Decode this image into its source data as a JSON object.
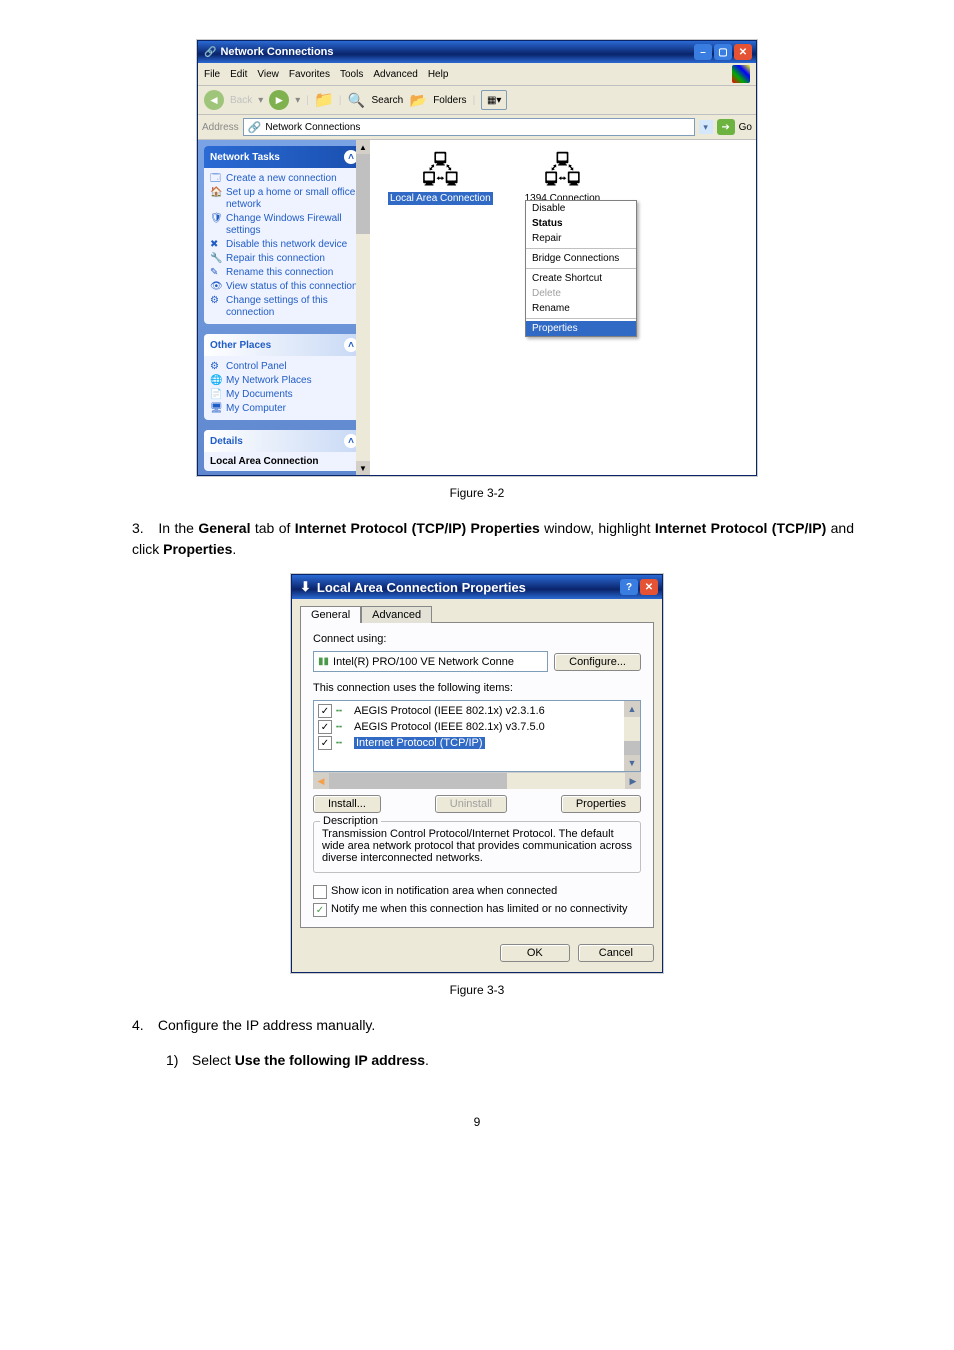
{
  "figure1": {
    "window_title": "Network Connections",
    "menu": [
      "File",
      "Edit",
      "View",
      "Favorites",
      "Tools",
      "Advanced",
      "Help"
    ],
    "toolbar": {
      "back": "Back",
      "search": "Search",
      "folders": "Folders"
    },
    "address_label": "Address",
    "address_value": "Network Connections",
    "go": "Go",
    "tasks": {
      "header": "Network Tasks",
      "items": [
        "Create a new connection",
        "Set up a home or small office network",
        "Change Windows Firewall settings",
        "Disable this network device",
        "Repair this connection",
        "Rename this connection",
        "View status of this connection",
        "Change settings of this connection"
      ]
    },
    "other_places": {
      "header": "Other Places",
      "items": [
        "Control Panel",
        "My Network Places",
        "My Documents",
        "My Computer"
      ]
    },
    "details": {
      "header": "Details",
      "title": "Local Area Connection"
    },
    "icons": {
      "lac": "Local Area Connection",
      "c1394": "1394 Connection"
    },
    "context_menu": {
      "disable": "Disable",
      "status": "Status",
      "repair": "Repair",
      "bridge": "Bridge Connections",
      "shortcut": "Create Shortcut",
      "delete": "Delete",
      "rename": "Rename",
      "properties": "Properties"
    },
    "caption": "Figure 3-2"
  },
  "step3": {
    "num": "3.",
    "text_before": "In the ",
    "bold1": "General",
    "text_mid1": " tab of ",
    "bold2": "Internet Protocol (TCP/IP) Properties",
    "text_mid2": " window, highlight ",
    "bold3": "Internet Protocol (TCP/IP)",
    "text_mid3": " and click ",
    "bold4": "Properties",
    "text_end": "."
  },
  "figure2": {
    "window_title": "Local Area Connection Properties",
    "tabs": {
      "general": "General",
      "advanced": "Advanced"
    },
    "connect_using_label": "Connect using:",
    "nic_value": "Intel(R) PRO/100 VE Network Conne",
    "configure_btn": "Configure...",
    "items_label": "This connection uses the following items:",
    "items": [
      "AEGIS Protocol (IEEE 802.1x) v2.3.1.6",
      "AEGIS Protocol (IEEE 802.1x) v3.7.5.0",
      "Internet Protocol (TCP/IP)"
    ],
    "install_btn": "Install...",
    "uninstall_btn": "Uninstall",
    "properties_btn": "Properties",
    "description_label": "Description",
    "description_text": "Transmission Control Protocol/Internet Protocol. The default wide area network protocol that provides communication across diverse interconnected networks.",
    "show_icon": "Show icon in notification area when connected",
    "notify": "Notify me when this connection has limited or no connectivity",
    "ok_btn": "OK",
    "cancel_btn": "Cancel",
    "caption": "Figure 3-3"
  },
  "step4": {
    "num": "4.",
    "text": "Configure the IP address manually."
  },
  "step4_1": {
    "num": "1)",
    "text_before": "Select ",
    "bold": "Use the following IP address",
    "text_end": "."
  },
  "page_number": "9"
}
